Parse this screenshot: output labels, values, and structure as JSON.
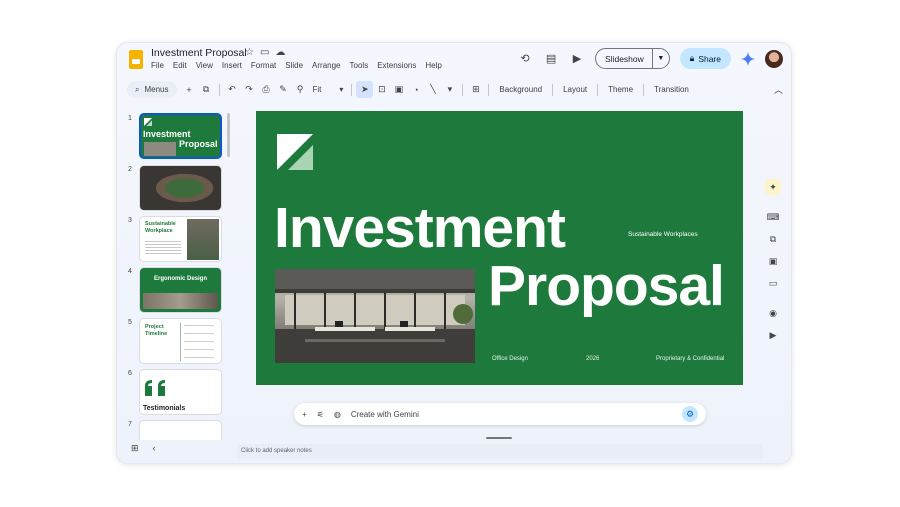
{
  "document": {
    "title": "Investment Proposal"
  },
  "menu": [
    "File",
    "Edit",
    "View",
    "Insert",
    "Format",
    "Slide",
    "Arrange",
    "Tools",
    "Extensions",
    "Help"
  ],
  "header": {
    "slideshow_label": "Slideshow",
    "share_label": "Share"
  },
  "toolbar": {
    "menus_label": "Menus",
    "zoom_label": "Fit",
    "background_label": "Background",
    "layout_label": "Layout",
    "theme_label": "Theme",
    "transition_label": "Transition"
  },
  "thumbnails": [
    {
      "number": "1",
      "text_1": "Investment",
      "text_2": "Proposal"
    },
    {
      "number": "2"
    },
    {
      "number": "3",
      "text_1": "Sustainable",
      "text_2": "Workplace"
    },
    {
      "number": "4",
      "text_1": "Ergonomic Design"
    },
    {
      "number": "5",
      "text_1": "Project",
      "text_2": "Timeline"
    },
    {
      "number": "6",
      "text_1": "Testimonials"
    },
    {
      "number": "7"
    }
  ],
  "slide": {
    "title_line_1": "Investment",
    "title_line_2": "Proposal",
    "subtitle": "Sustainable Workplaces",
    "footer_left": "Office Design",
    "footer_mid": "2026",
    "footer_right": "Proprietary & Confidential",
    "background_color": "#1e7a3c"
  },
  "gemini": {
    "placeholder": "Create with Gemini"
  },
  "notes": {
    "placeholder": "Click to add speaker notes"
  },
  "colors": {
    "accent": "#0b57d0",
    "share_bg": "#c2e7ff",
    "app_logo": "#f6b400"
  }
}
